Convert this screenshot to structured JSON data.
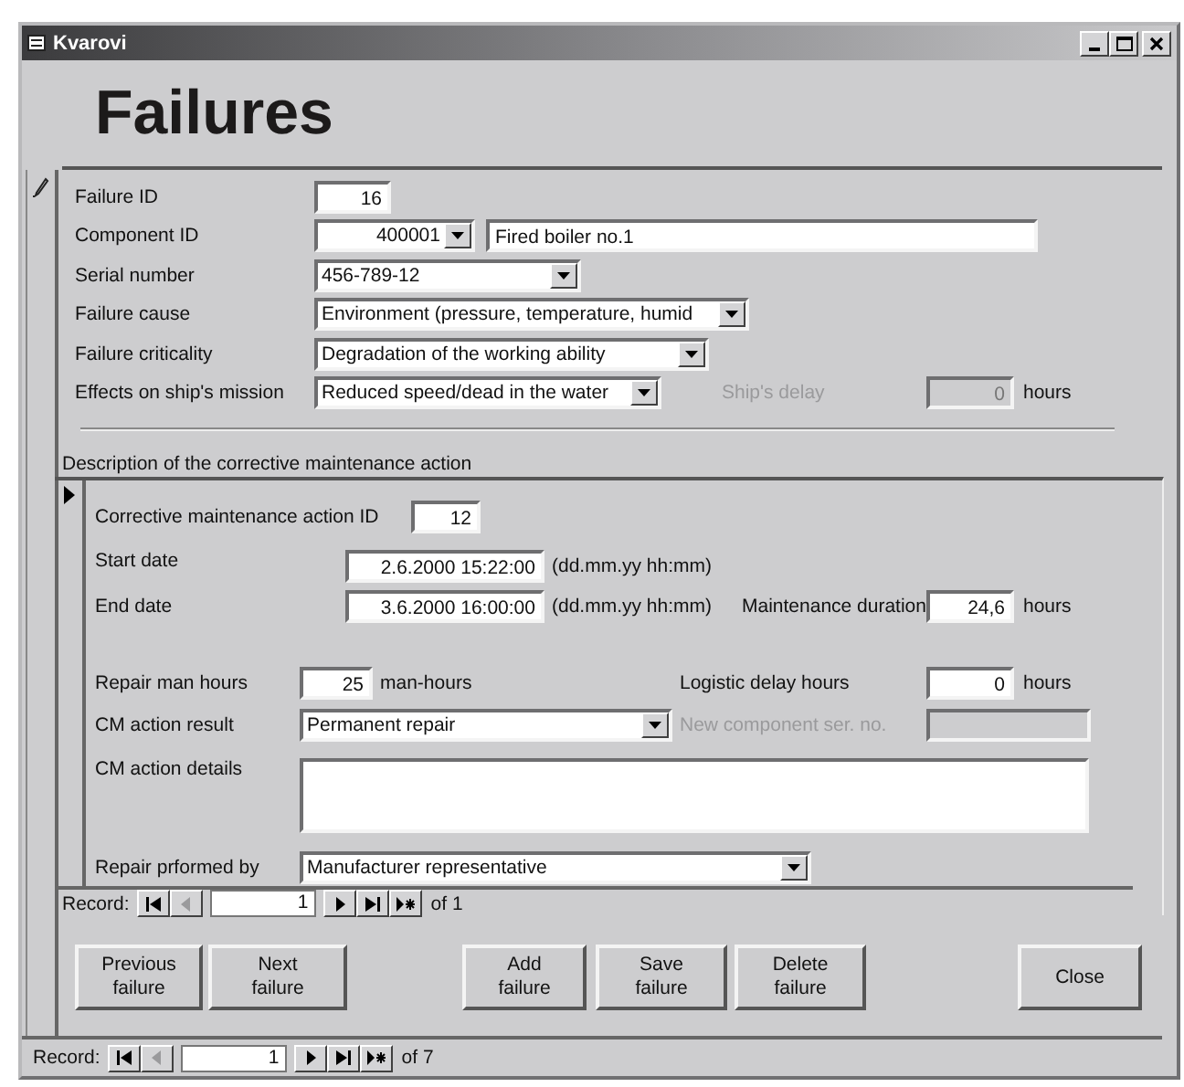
{
  "window": {
    "title": "Kvarovi"
  },
  "form_title": "Failures",
  "failure_fields": [
    {
      "label": "Failure ID",
      "kind": "number",
      "value": "16"
    },
    {
      "label": "Component ID",
      "kind": "number_combo",
      "value": "400001",
      "description": "Fired boiler no.1"
    },
    {
      "label": "Serial number",
      "kind": "combo",
      "value": "456-789-12"
    },
    {
      "label": "Failure cause",
      "kind": "combo",
      "value": "Environment (pressure, temperature, humid"
    },
    {
      "label": "Failure criticality",
      "kind": "combo",
      "value": "Degradation of the working ability"
    },
    {
      "label": "Effects on ship's mission",
      "kind": "combo",
      "value": "Reduced speed/dead in the water",
      "side": {
        "label": "Ship's delay",
        "value": "0",
        "unit": "hours",
        "disabled": true
      }
    }
  ],
  "subform": {
    "title": "Description of the corrective maintenance action",
    "rows": [
      {
        "label": "Corrective maintenance action ID",
        "kind": "number",
        "value": "12"
      },
      {
        "label": "Start date",
        "kind": "number",
        "value": "2.6.2000 15:22:00",
        "suffix": "(dd.mm.yy hh:mm)"
      },
      {
        "label": "End date",
        "kind": "number",
        "value": "3.6.2000 16:00:00",
        "suffix": "(dd.mm.yy hh:mm)",
        "side": {
          "label": "Maintenance duration",
          "value": "24,6",
          "unit": "hours",
          "disabled": false
        }
      },
      {
        "label": "Repair man hours",
        "kind": "number",
        "value": "25",
        "suffix": "man-hours",
        "side": {
          "label": "Logistic delay hours",
          "value": "0",
          "unit": "hours",
          "disabled": false
        }
      },
      {
        "label": "CM action result",
        "kind": "combo",
        "value": "Permanent repair",
        "side": {
          "label": "New component ser. no.",
          "disabled": true
        }
      },
      {
        "label": "CM action details",
        "kind": "memo"
      },
      {
        "label": "Repair prformed by",
        "kind": "combo",
        "value": "Manufacturer representative"
      }
    ],
    "navigation": {
      "label": "Record:",
      "value": "1",
      "total": "of 1",
      "buttons": [
        {
          "kind": "first",
          "disabled": false
        },
        {
          "kind": "prev",
          "disabled": true
        },
        {
          "kind": "next",
          "disabled": false
        },
        {
          "kind": "last",
          "disabled": false
        },
        {
          "kind": "new",
          "disabled": false
        }
      ]
    }
  },
  "buttons": [
    {
      "label": "Previous\nfailure"
    },
    {
      "label": "Next\nfailure"
    },
    {
      "label": "Add\nfailure"
    },
    {
      "label": "Save\nfailure"
    },
    {
      "label": "Delete\nfailure"
    },
    {
      "label": "Close"
    }
  ],
  "navigation": {
    "label": "Record:",
    "value": "1",
    "total": "of 7",
    "buttons": [
      {
        "kind": "first",
        "disabled": false
      },
      {
        "kind": "prev",
        "disabled": true
      },
      {
        "kind": "next",
        "disabled": false
      },
      {
        "kind": "last",
        "disabled": false
      },
      {
        "kind": "new",
        "disabled": false
      }
    ]
  }
}
